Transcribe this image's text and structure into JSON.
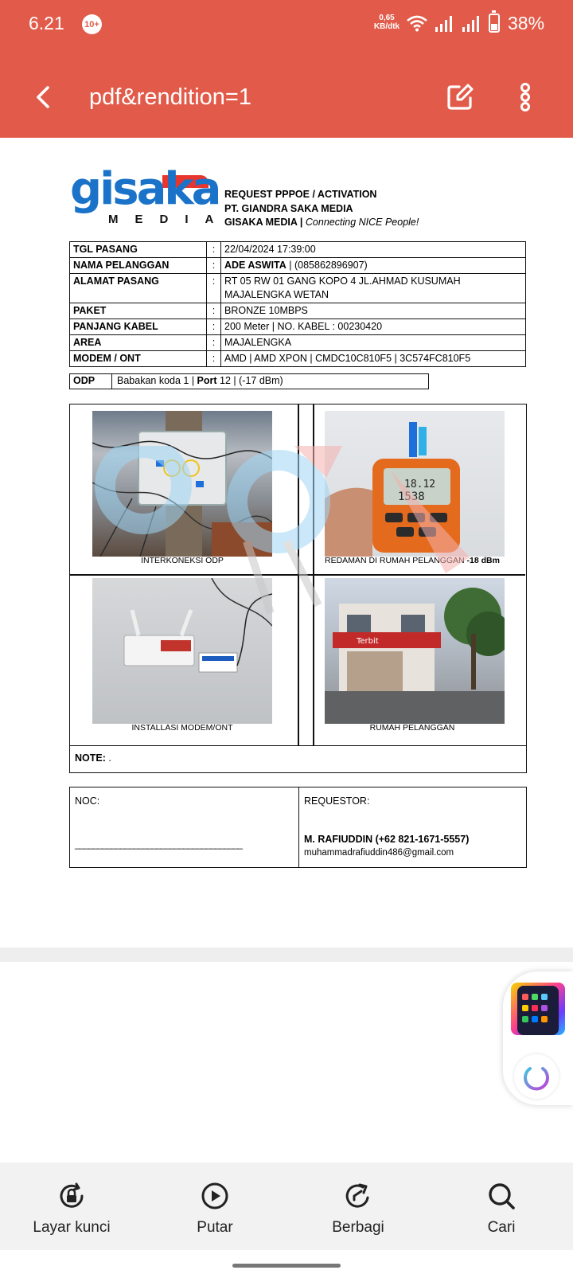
{
  "status_bar": {
    "time": "6.21",
    "notif_badge": "10+",
    "net_speed_value": "0,65",
    "net_speed_unit": "KB/dtk",
    "battery": "38%"
  },
  "app_bar": {
    "title": "pdf&rendition=1"
  },
  "document": {
    "logo_word": "gisaka",
    "logo_sub": "MEDIA",
    "header": {
      "line1": "REQUEST PPPOE / ACTIVATION",
      "line2": "PT. GIANDRA SAKA MEDIA",
      "line3_bold": "GISAKA MEDIA |",
      "line3_italic": "Connecting NICE People!"
    },
    "info_rows": [
      {
        "key": "TGL PASANG",
        "colon": ":",
        "value": "22/04/2024 17:39:00"
      },
      {
        "key": "NAMA PELANGGAN",
        "colon": ":",
        "value_bold": "ADE ASWITA",
        "value": " | (085862896907)"
      },
      {
        "key": "ALAMAT PASANG",
        "colon": ":",
        "value": "RT 05 RW 01 GANG KOPO 4 JL.AHMAD KUSUMAH",
        "value2": "MAJALENGKA WETAN"
      },
      {
        "key": "PAKET",
        "colon": ":",
        "value": "BRONZE 10MBPS"
      },
      {
        "key": "PANJANG KABEL",
        "colon": ":",
        "value": "200  Meter  | NO. KABEL : 00230420"
      },
      {
        "key": "AREA",
        "colon": ":",
        "value": "MAJALENGKA"
      },
      {
        "key": "MODEM / ONT",
        "colon": ":",
        "value": "AMD |  AMD XPON | CMDC10C810F5 |  3C574FC810F5"
      }
    ],
    "odp": {
      "label": "ODP",
      "value_a": "Babakan koda 1  |  ",
      "port_label": "Port",
      "value_b": " 12 |  (-17 dBm)"
    },
    "photos": [
      {
        "caption": "INTERKONEKSI ODP"
      },
      {
        "caption": "REDAMAN DI RUMAH PELANGGAN ",
        "caption_bold": "-18 dBm"
      },
      {
        "caption": "INSTALLASI MODEM/ONT"
      },
      {
        "caption": "RUMAH PELANGGAN"
      }
    ],
    "meter_reading_1": "18.12",
    "meter_reading_2": "1538",
    "shop_sign": "Terbit",
    "note_label": "NOTE:",
    "note_value": ".",
    "noc_label": "NOC:",
    "noc_line": "_____________________________________",
    "requestor_label": "REQUESTOR:",
    "requestor_name": "M. RAFIUDDIN (+62 821-1671-5557)",
    "requestor_email": "muhammadrafiuddin486@gmail.com"
  },
  "toolbar": {
    "items": [
      {
        "label": "Layar kunci",
        "icon": "lock-screen-icon"
      },
      {
        "label": "Putar",
        "icon": "play-icon"
      },
      {
        "label": "Berbagi",
        "icon": "share-icon"
      },
      {
        "label": "Cari",
        "icon": "search-icon"
      }
    ]
  },
  "colors": {
    "app_bar": "#E25B4A",
    "logo_blue": "#1A73C8",
    "logo_red": "#E8352D"
  }
}
